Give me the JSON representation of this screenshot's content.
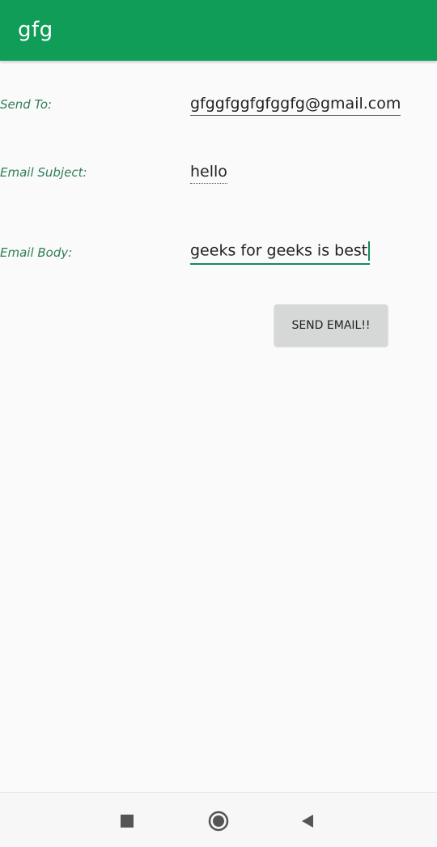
{
  "app_bar": {
    "title": "gfg",
    "color": "#0f9d58"
  },
  "form": {
    "send_to": {
      "label": "Send To:",
      "value": "gfggfggfgfggfg@gmail.com"
    },
    "subject": {
      "label": "Email Subject:",
      "value": "hello"
    },
    "body": {
      "label": "Email Body:",
      "value": "geeks for geeks is best"
    },
    "send_button_label": "SEND EMAIL!!"
  },
  "nav_bar": {
    "items": [
      {
        "icon": "recents-square-icon"
      },
      {
        "icon": "home-circle-icon"
      },
      {
        "icon": "back-triangle-icon"
      }
    ]
  },
  "colors": {
    "accent": "#0f9d58",
    "label_text": "#2f7d5a",
    "button_bg": "#d6d7d7"
  }
}
